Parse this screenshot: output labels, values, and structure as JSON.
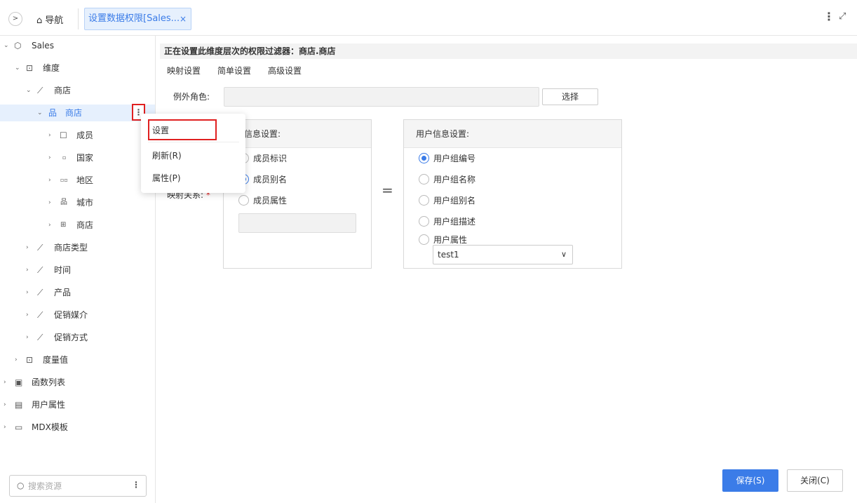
{
  "topbar": {
    "nav_label": "导航",
    "tab_label": "设置数据权限[Sales...",
    "tab_close": "×",
    "expand_toggle": ">",
    "more": "⋮",
    "maximize": "⤢"
  },
  "sidebar": {
    "tree": [
      {
        "label": "Sales",
        "icon": "cube-icon"
      },
      {
        "label": "维度",
        "icon": "dimension-icon"
      },
      {
        "label": "商店",
        "icon": "hierarchy-chart-icon"
      },
      {
        "label": "商店",
        "icon": "org-tree-icon"
      },
      {
        "label": "成员",
        "icon": "member-icon"
      },
      {
        "label": "国家",
        "icon": "level-one-icon"
      },
      {
        "label": "地区",
        "icon": "level-two-icon"
      },
      {
        "label": "城市",
        "icon": "level-three-icon"
      },
      {
        "label": "商店",
        "icon": "level-four-icon"
      },
      {
        "label": "商店类型",
        "icon": "hierarchy-chart-icon"
      },
      {
        "label": "时间",
        "icon": "hierarchy-chart-icon"
      },
      {
        "label": "产品",
        "icon": "hierarchy-chart-icon"
      },
      {
        "label": "促销媒介",
        "icon": "hierarchy-chart-icon"
      },
      {
        "label": "促销方式",
        "icon": "hierarchy-chart-icon"
      },
      {
        "label": "度量值",
        "icon": "measure-icon"
      },
      {
        "label": "函数列表",
        "icon": "function-icon"
      },
      {
        "label": "用户属性",
        "icon": "user-attribute-icon"
      },
      {
        "label": "MDX模板",
        "icon": "mdx-icon"
      }
    ],
    "search_placeholder": "搜索资源"
  },
  "context_menu": {
    "items": [
      "设置",
      "刷新(R)",
      "属性(P)"
    ]
  },
  "main": {
    "filter_title": "正在设置此维度层次的权限过滤器：商店.商店",
    "subtabs": [
      "映射设置",
      "简单设置",
      "高级设置"
    ],
    "exception_label": "例外角色:",
    "choose_button": "选择",
    "mapping_label": "映射关系:",
    "required_mark": "*",
    "left_panel": {
      "title": "度信息设置:",
      "options": [
        "成员标识",
        "成员别名",
        "成员属性"
      ],
      "selected": 1
    },
    "equals": "=",
    "right_panel": {
      "title": "用户信息设置:",
      "options": [
        "用户组编号",
        "用户组名称",
        "用户组别名",
        "用户组描述",
        "用户属性"
      ],
      "selected": 0,
      "attribute_value": "test1"
    },
    "save_button": "保存(S)",
    "close_button": "关闭(C)"
  },
  "colors": {
    "accent": "#3b7ce8",
    "highlight_border": "#e02020",
    "selected_bg": "#e6f0fd"
  }
}
